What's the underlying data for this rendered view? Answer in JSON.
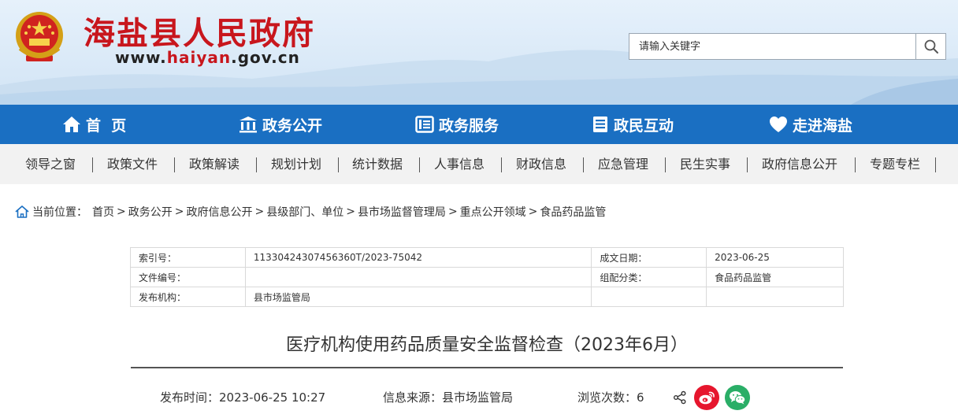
{
  "header": {
    "site_title": "海盐县人民政府",
    "site_url_prefix": "www.",
    "site_url_highlight": "haiyan",
    "site_url_suffix": ".gov.cn"
  },
  "search": {
    "placeholder": "请输入关键字",
    "icon": "search-icon"
  },
  "main_nav": [
    {
      "label": "首  页",
      "icon": "home-icon"
    },
    {
      "label": "政务公开",
      "icon": "government-building-icon"
    },
    {
      "label": "政务服务",
      "icon": "document-list-icon"
    },
    {
      "label": "政民互动",
      "icon": "clipboard-list-icon"
    },
    {
      "label": "走进海盐",
      "icon": "heart-icon"
    }
  ],
  "sub_nav": [
    "领导之窗",
    "政策文件",
    "政策解读",
    "规划计划",
    "统计数据",
    "人事信息",
    "财政信息",
    "应急管理",
    "民生实事",
    "政府信息公开",
    "专题专栏"
  ],
  "breadcrumb": {
    "label": "当前位置：",
    "items": [
      "首页",
      "政务公开",
      "政府信息公开",
      "县级部门、单位",
      "县市场监督管理局",
      "重点公开领域",
      "食品药品监管"
    ],
    "separator": ">"
  },
  "info_table": {
    "rows": [
      [
        "索引号：",
        "11330424307456360T/2023-75042",
        "成文日期：",
        "2023-06-25"
      ],
      [
        "文件编号：",
        "",
        "组配分类：",
        "食品药品监管"
      ],
      [
        "发布机构：",
        "县市场监管局",
        "",
        ""
      ]
    ]
  },
  "article": {
    "title": "医疗机构使用药品质量安全监督检查（2023年6月）",
    "publish_time": "发布时间：2023-06-25 10:27",
    "source": "信息来源：县市场监管局",
    "views": "浏览次数：6"
  },
  "share": {
    "icons": [
      "share-icon",
      "weibo-icon",
      "wechat-icon"
    ]
  },
  "colors": {
    "title_red": "#c8161d",
    "nav_blue": "#1a6fc2",
    "subnav_bg": "#f2f2f2",
    "weibo_red": "#e6162d",
    "wechat_green": "#2aae67"
  }
}
